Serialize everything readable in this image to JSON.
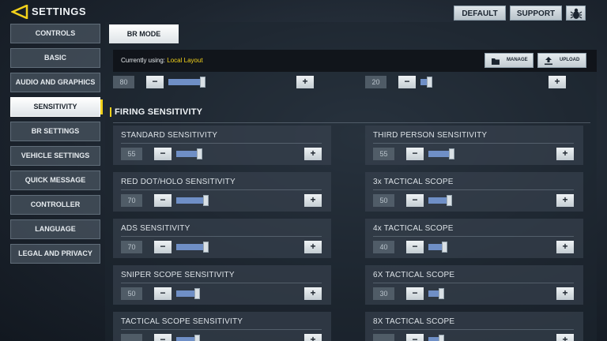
{
  "header": {
    "title": "SETTINGS",
    "default_label": "DEFAULT",
    "support_label": "SUPPORT",
    "bug_icon": "bug-icon",
    "accent": "#f2d11b"
  },
  "sidebar": {
    "items": [
      {
        "label": "CONTROLS",
        "active": false
      },
      {
        "label": "BASIC",
        "active": false
      },
      {
        "label": "AUDIO AND GRAPHICS",
        "active": false
      },
      {
        "label": "SENSITIVITY",
        "active": true
      },
      {
        "label": "BR SETTINGS",
        "active": false
      },
      {
        "label": "VEHICLE SETTINGS",
        "active": false
      },
      {
        "label": "QUICK MESSAGE",
        "active": false
      },
      {
        "label": "CONTROLLER",
        "active": false
      },
      {
        "label": "LANGUAGE",
        "active": false
      },
      {
        "label": "LEGAL AND PRIVACY",
        "active": false
      }
    ]
  },
  "main": {
    "tab_label": "BR MODE",
    "layout": {
      "prefix": "Currently using:",
      "name": "Local Layout",
      "manage_label": "MANAGE",
      "upload_label": "UPLOAD"
    },
    "partial_rows": [
      {
        "value": "80",
        "level": 0.28
      },
      {
        "value": "20",
        "level": 0.07
      }
    ],
    "section_title": "FIRING SENSITIVITY",
    "settings_left": [
      {
        "label": "STANDARD SENSITIVITY",
        "value": "55",
        "level": 0.19
      },
      {
        "label": "RED DOT/HOLO SENSITIVITY",
        "value": "70",
        "level": 0.24
      },
      {
        "label": "ADS SENSITIVITY",
        "value": "70",
        "level": 0.24
      },
      {
        "label": "SNIPER SCOPE SENSITIVITY",
        "value": "50",
        "level": 0.17
      },
      {
        "label": "TACTICAL SCOPE SENSITIVITY",
        "value": "",
        "level": 0.17
      }
    ],
    "settings_right": [
      {
        "label": "THIRD PERSON SENSITIVITY",
        "value": "55",
        "level": 0.19
      },
      {
        "label": "3x TACTICAL SCOPE",
        "value": "50",
        "level": 0.17
      },
      {
        "label": "4x TACTICAL SCOPE",
        "value": "40",
        "level": 0.13
      },
      {
        "label": "6X TACTICAL SCOPE",
        "value": "30",
        "level": 0.1
      },
      {
        "label": "8X TACTICAL SCOPE",
        "value": "",
        "level": 0.1
      }
    ],
    "plus_symbol": "+",
    "minus_symbol": "−"
  }
}
